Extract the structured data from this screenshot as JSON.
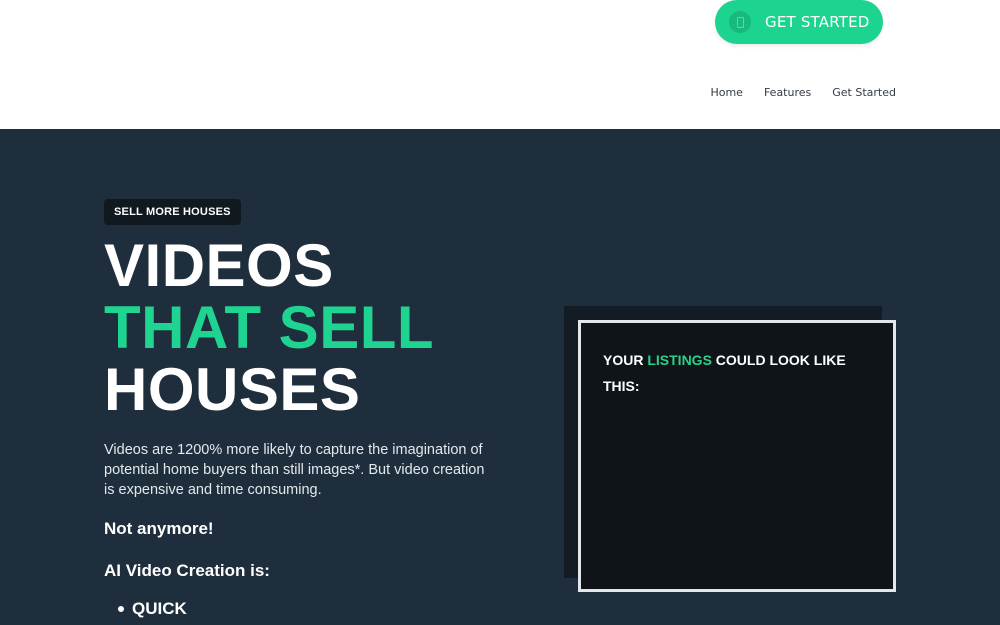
{
  "header": {
    "cta_label": "GET STARTED",
    "cta_icon": "mobile-phone-icon",
    "nav": [
      "Home",
      "Features",
      "Get Started"
    ]
  },
  "hero": {
    "badge": "SELL MORE HOUSES",
    "headline": {
      "line1": "VIDEOS",
      "line2": "THAT SELL",
      "line3": "HOUSES"
    },
    "body": "Videos are 1200% more likely to capture the imagination of potential home buyers than still images*.  But video creation is expensive and time consuming.",
    "not_anymore": "Not anymore!",
    "ai_label": "AI Video Creation is:",
    "bullets": [
      "QUICK"
    ]
  },
  "preview": {
    "text_before": "YOUR ",
    "text_highlight": "LISTINGS",
    "text_after": " COULD LOOK LIKE THIS:"
  },
  "colors": {
    "accent": "#1dd390",
    "hero_bg": "#1f2e3c",
    "preview_bg": "#0f1419"
  }
}
